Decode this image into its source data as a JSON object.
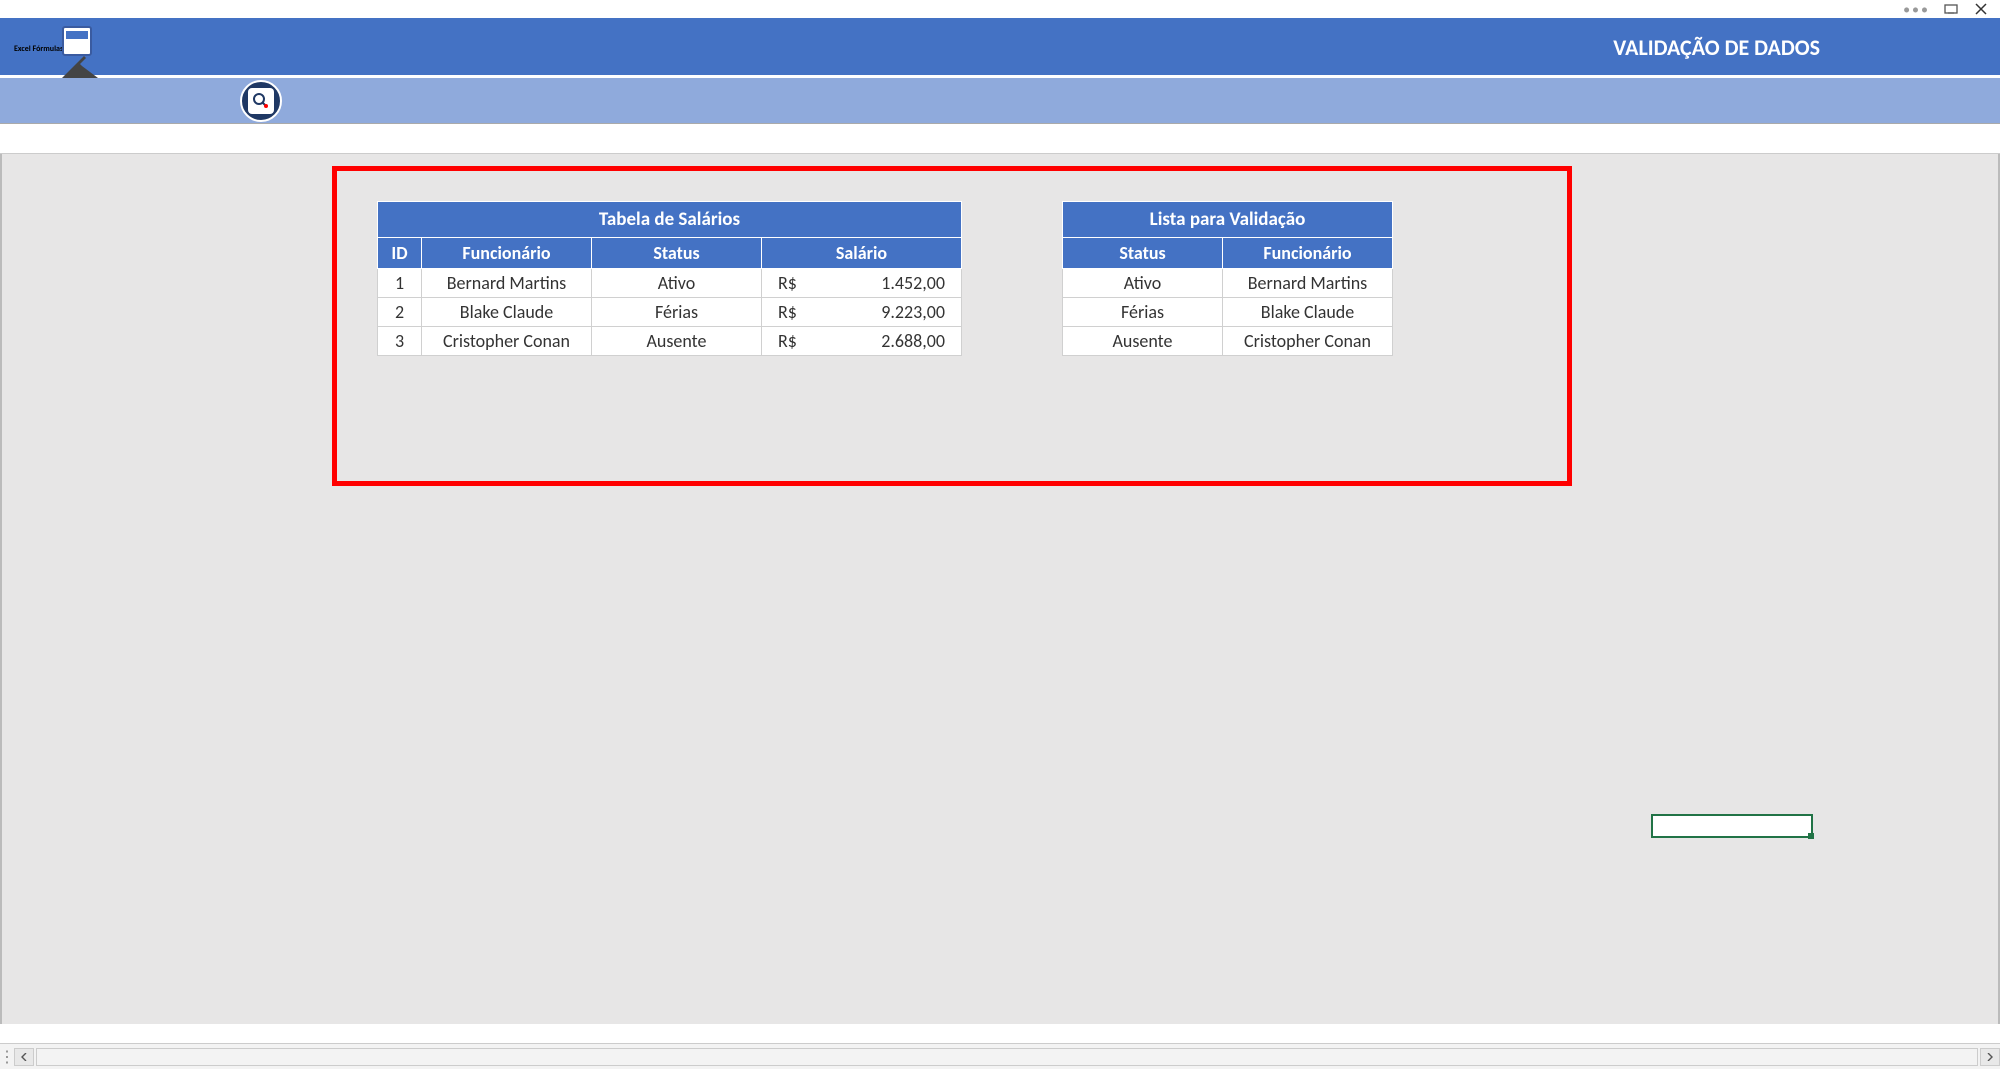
{
  "window": {
    "title": "VALIDAÇÃO DE DADOS",
    "logo_label": "Excel Fórmulas"
  },
  "table1": {
    "title": "Tabela de Salários",
    "headers": {
      "id": "ID",
      "funcionario": "Funcionário",
      "status": "Status",
      "salario": "Salário"
    },
    "rows": [
      {
        "id": "1",
        "funcionario": "Bernard Martins",
        "status": "Ativo",
        "moeda": "R$",
        "salario": "1.452,00"
      },
      {
        "id": "2",
        "funcionario": "Blake Claude",
        "status": "Férias",
        "moeda": "R$",
        "salario": "9.223,00"
      },
      {
        "id": "3",
        "funcionario": "Cristopher Conan",
        "status": "Ausente",
        "moeda": "R$",
        "salario": "2.688,00"
      }
    ]
  },
  "table2": {
    "title": "Lista para Validação",
    "headers": {
      "status": "Status",
      "funcionario": "Funcionário"
    },
    "rows": [
      {
        "status": "Ativo",
        "funcionario": "Bernard Martins"
      },
      {
        "status": "Férias",
        "funcionario": "Blake Claude"
      },
      {
        "status": "Ausente",
        "funcionario": "Cristopher Conan"
      }
    ]
  }
}
